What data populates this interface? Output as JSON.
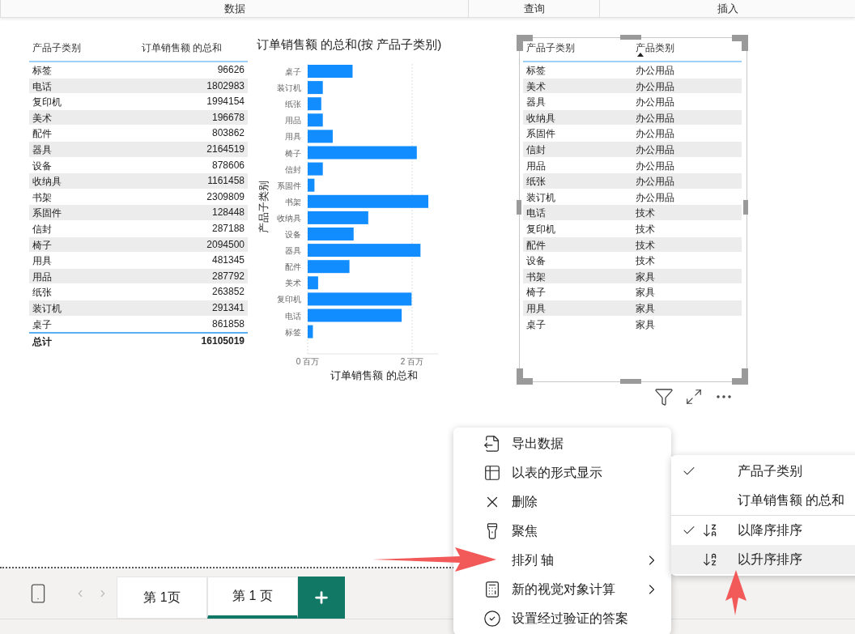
{
  "ribbon": {
    "sections": [
      {
        "label": "数据"
      },
      {
        "label": "查询"
      },
      {
        "label": "插入"
      }
    ]
  },
  "table_left": {
    "columns": [
      {
        "label": "产品子类别"
      },
      {
        "label": "订单销售额 的总和"
      }
    ],
    "rows": [
      [
        "标签",
        "96626"
      ],
      [
        "电话",
        "1802983"
      ],
      [
        "复印机",
        "1994154"
      ],
      [
        "美术",
        "196678"
      ],
      [
        "配件",
        "803862"
      ],
      [
        "器具",
        "2164519"
      ],
      [
        "设备",
        "878606"
      ],
      [
        "收纳具",
        "1161458"
      ],
      [
        "书架",
        "2309809"
      ],
      [
        "系固件",
        "128448"
      ],
      [
        "信封",
        "287188"
      ],
      [
        "椅子",
        "2094500"
      ],
      [
        "用具",
        "481345"
      ],
      [
        "用品",
        "287792"
      ],
      [
        "纸张",
        "263852"
      ],
      [
        "装订机",
        "291341"
      ],
      [
        "桌子",
        "861858"
      ]
    ],
    "total": [
      "总计",
      "16105019"
    ]
  },
  "bar_chart": {
    "chart_data": {
      "type": "bar",
      "orientation": "horizontal",
      "title": "订单销售额 的总和(按 产品子类别)",
      "xlabel": "订单销售额 的总和",
      "ylabel": "产品子类别",
      "categories": [
        "桌子",
        "装订机",
        "纸张",
        "用品",
        "用具",
        "椅子",
        "信封",
        "系固件",
        "书架",
        "收纳具",
        "设备",
        "器具",
        "配件",
        "美术",
        "复印机",
        "电话",
        "标签"
      ],
      "values": [
        0.86,
        0.29,
        0.26,
        0.29,
        0.48,
        2.09,
        0.29,
        0.13,
        2.31,
        1.16,
        0.88,
        2.16,
        0.8,
        0.2,
        1.99,
        1.8,
        0.1
      ],
      "xlim": [
        0,
        2.5
      ],
      "xticks": [
        {
          "value": 0,
          "label": "0 百万"
        },
        {
          "value": 2,
          "label": "2 百万"
        }
      ]
    }
  },
  "table_right": {
    "columns": [
      {
        "label": "产品子类别",
        "sorted": false
      },
      {
        "label": "产品类别",
        "sorted": true
      }
    ],
    "rows": [
      [
        "标签",
        "办公用品"
      ],
      [
        "美术",
        "办公用品"
      ],
      [
        "器具",
        "办公用品"
      ],
      [
        "收纳具",
        "办公用品"
      ],
      [
        "系固件",
        "办公用品"
      ],
      [
        "信封",
        "办公用品"
      ],
      [
        "用品",
        "办公用品"
      ],
      [
        "纸张",
        "办公用品"
      ],
      [
        "装订机",
        "办公用品"
      ],
      [
        "电话",
        "技术"
      ],
      [
        "复印机",
        "技术"
      ],
      [
        "配件",
        "技术"
      ],
      [
        "设备",
        "技术"
      ],
      [
        "书架",
        "家具"
      ],
      [
        "椅子",
        "家具"
      ],
      [
        "用具",
        "家具"
      ],
      [
        "桌子",
        "家具"
      ]
    ]
  },
  "context_menu": {
    "items": [
      {
        "label": "导出数据",
        "submenu": false
      },
      {
        "label": "以表的形式显示",
        "submenu": false
      },
      {
        "label": "删除",
        "submenu": false
      },
      {
        "label": "聚焦",
        "submenu": false
      },
      {
        "label": "排列 轴",
        "submenu": true
      },
      {
        "label": "新的视觉对象计算",
        "submenu": true
      },
      {
        "label": "设置经过验证的答案",
        "submenu": false
      }
    ]
  },
  "submenu": {
    "items": [
      {
        "kind": "field",
        "label": "产品子类别",
        "checked": true,
        "highlighted": false
      },
      {
        "kind": "field",
        "label": "订单销售额 的总和",
        "checked": false,
        "highlighted": false
      },
      {
        "kind": "sort_desc",
        "label": "以降序排序",
        "checked": true,
        "highlighted": false
      },
      {
        "kind": "sort_asc",
        "label": "以升序排序",
        "checked": false,
        "highlighted": true
      }
    ]
  },
  "page_tabs": [
    {
      "label": "第 1页",
      "selected": false
    },
    {
      "label": "第 1 页",
      "selected": true
    }
  ]
}
